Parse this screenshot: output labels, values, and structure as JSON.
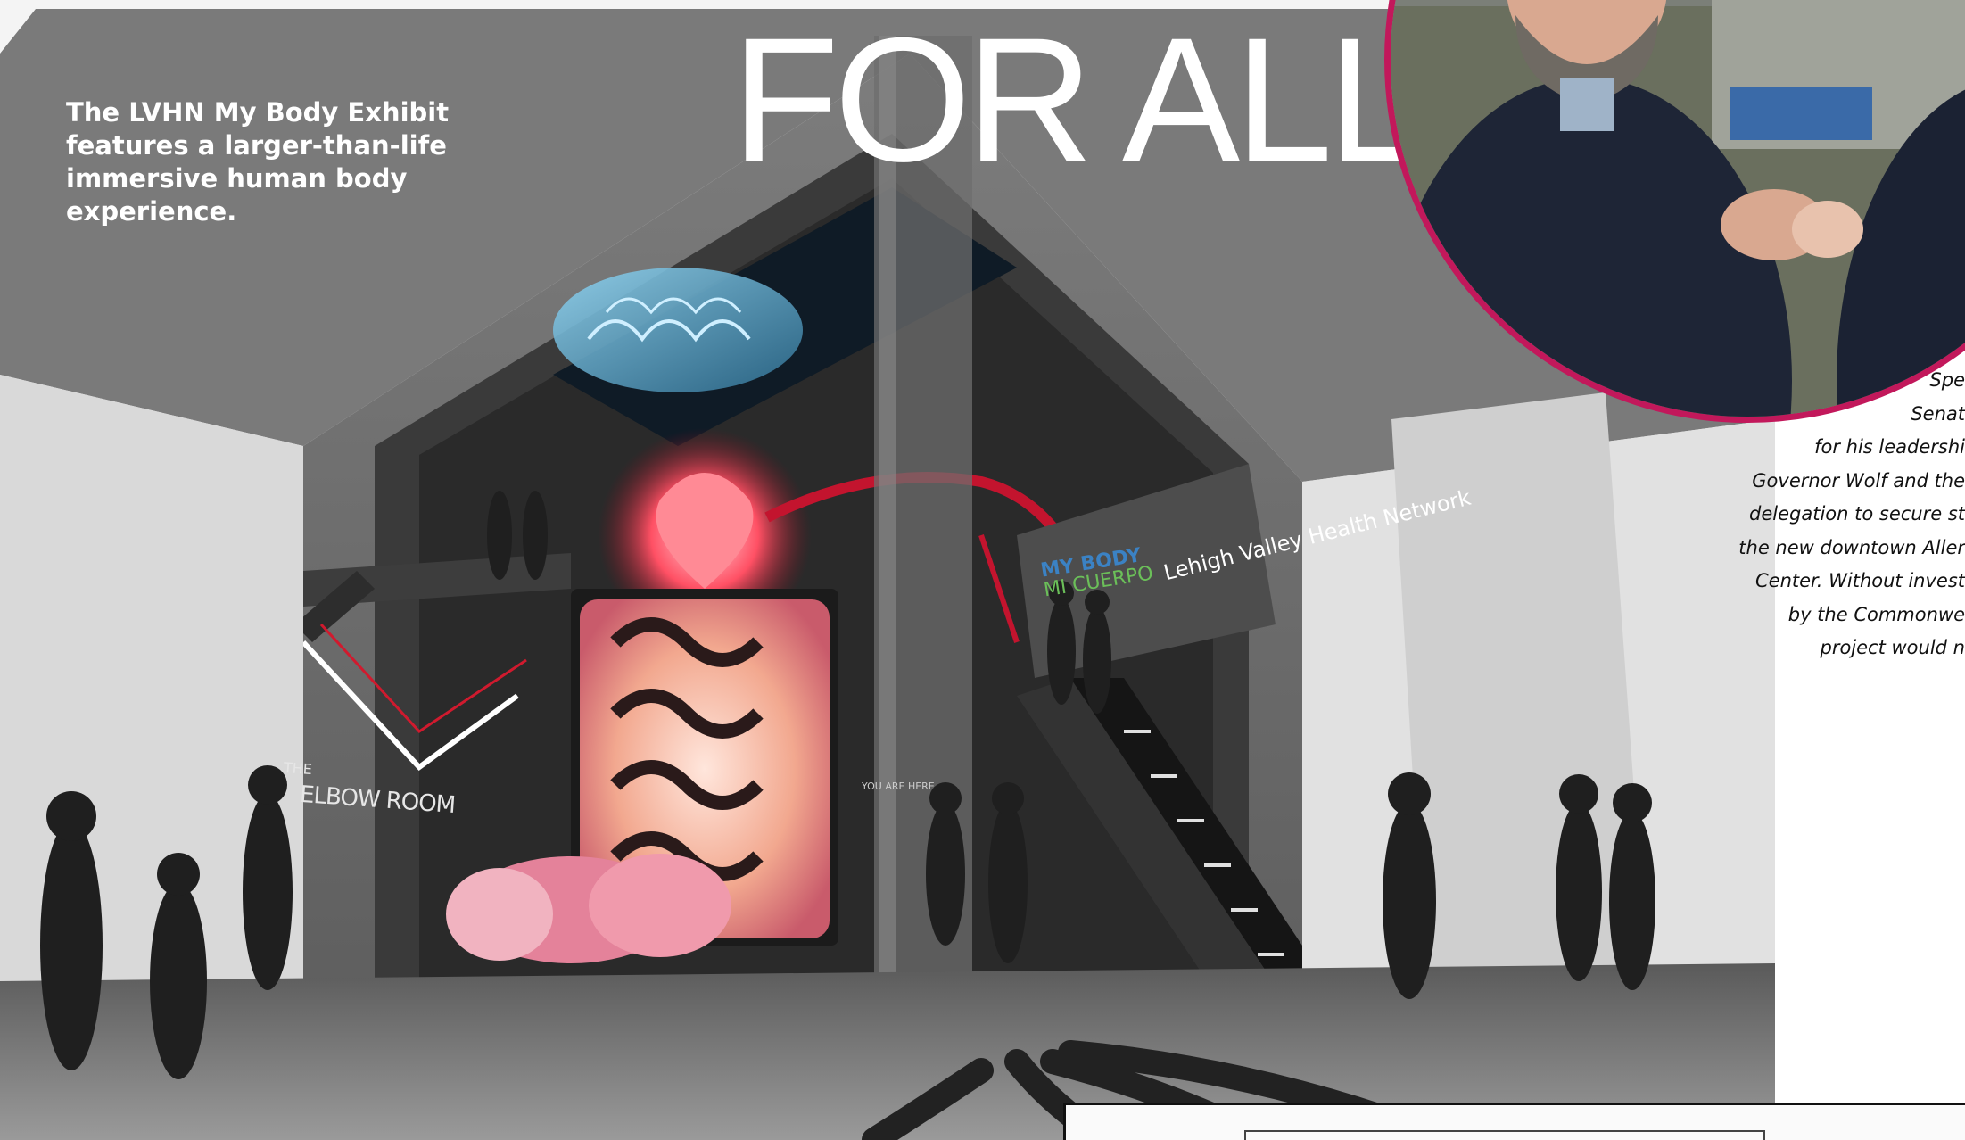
{
  "headline": "FOR ALL",
  "caption": "The LVHN My Body Exhibit features a larger-than-life immersive human body experience.",
  "signage": {
    "my_body": "MY BODY",
    "mi_cuerpo": "MI CUERPO",
    "lvhn": "Lehigh Valley Health Network",
    "elbow_the": "THE",
    "elbow_room": "ELBOW ROOM",
    "you_are_here": "YOU ARE HERE"
  },
  "body_lines": [
    "Spe",
    "Senat",
    "for his leadershi",
    "Governor Wolf and the",
    "delegation to secure st",
    "the new downtown Aller",
    "Center.  Without invest",
    "by the Commonwe",
    "project would n"
  ],
  "colors": {
    "photo_border": "#c2185b",
    "wall": "#6b6b6b",
    "heart_glow": "#e23b4a",
    "organ_glow": "#f4b4a8"
  }
}
